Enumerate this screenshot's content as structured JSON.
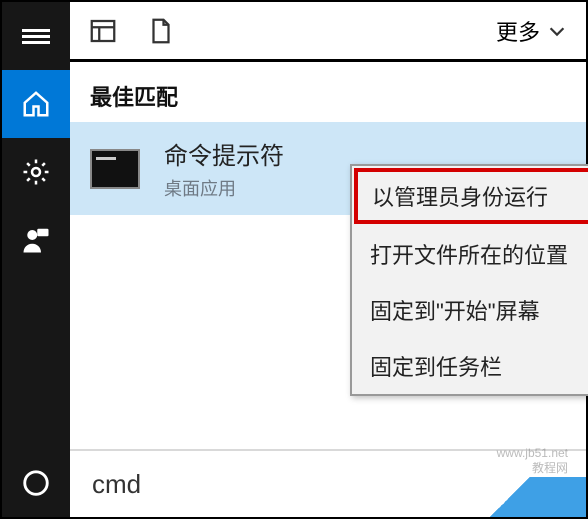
{
  "topbar": {
    "more_label": "更多"
  },
  "section": {
    "best_match": "最佳匹配"
  },
  "result": {
    "title": "命令提示符",
    "subtitle": "桌面应用"
  },
  "context_menu": {
    "items": [
      "以管理员身份运行",
      "打开文件所在的位置",
      "固定到\"开始\"屏幕",
      "固定到任务栏"
    ]
  },
  "search": {
    "value": "cmd"
  },
  "watermark": {
    "line1": "www.jb51.net",
    "line2": "教程网"
  }
}
